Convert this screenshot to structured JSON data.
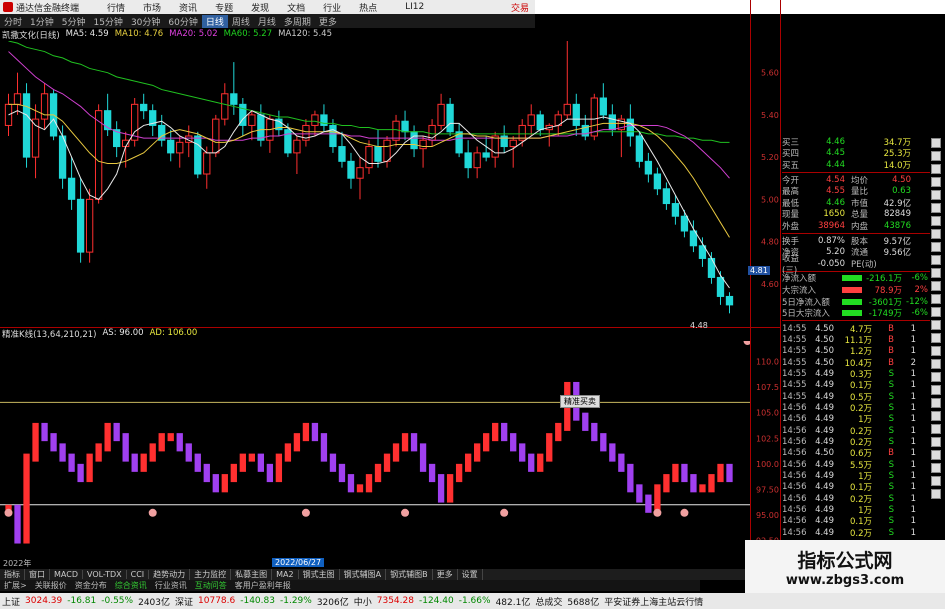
{
  "top_menu": {
    "app_title": "通达信金融终端",
    "items": [
      "行情",
      "市场",
      "资讯",
      "专题",
      "发现",
      "文档",
      "行业",
      "热点"
    ],
    "code": "LI12",
    "corner": "交易"
  },
  "period_bar": {
    "items": [
      "分时",
      "1分钟",
      "5分钟",
      "15分钟",
      "30分钟",
      "60分钟",
      "日线",
      "周线",
      "月线",
      "多周期",
      "更多"
    ],
    "active": "日线"
  },
  "ma_legend": {
    "name": "凯撒文化(日线)",
    "items": [
      {
        "label": "MA5: 4.59",
        "color": "#e8e8e8"
      },
      {
        "label": "MA10: 4.76",
        "color": "#e8d040"
      },
      {
        "label": "MA20: 5.02",
        "color": "#e040e0"
      },
      {
        "label": "MA60: 5.27",
        "color": "#20d020"
      },
      {
        "label": "MA120: 5.45",
        "color": "#cccccc"
      }
    ]
  },
  "indicator_legend": {
    "name": "精准K线(13,64,210,21)",
    "items": [
      "AS: 96.00",
      "AD: 106.00"
    ]
  },
  "price_axis": [
    "5.60",
    "5.40",
    "5.20",
    "5.00",
    "4.80",
    "4.60"
  ],
  "ind_axis": [
    "110.0",
    "107.5",
    "105.0",
    "102.5",
    "100.0",
    "97.50",
    "95.00",
    "92.50"
  ],
  "last_price_tag": "4.81",
  "low_label": "4.48",
  "floating_tip": "精准买卖",
  "date_start": "2022年",
  "date_label": "2022/06/27",
  "quote": {
    "bids": [
      {
        "label": "买三",
        "price": "4.46",
        "vol": "34.7万"
      },
      {
        "label": "买四",
        "price": "4.45",
        "vol": "25.3万"
      },
      {
        "label": "买五",
        "price": "4.44",
        "vol": "14.0万"
      }
    ],
    "stats": [
      {
        "l": "今开",
        "v": "4.54",
        "vc": "up",
        "l2": "均价",
        "v2": "4.50",
        "v2c": "up"
      },
      {
        "l": "最高",
        "v": "4.55",
        "vc": "up",
        "l2": "量比",
        "v2": "0.63",
        "v2c": "down"
      },
      {
        "l": "最低",
        "v": "4.46",
        "vc": "down",
        "l2": "市值",
        "v2": "42.9亿",
        "v2c": "neu"
      },
      {
        "l": "现量",
        "v": "1650",
        "vc": "yel",
        "l2": "总量",
        "v2": "82849",
        "v2c": "neu"
      },
      {
        "l": "外盘",
        "v": "38964",
        "vc": "up",
        "l2": "内盘",
        "v2": "43876",
        "v2c": "down"
      }
    ],
    "stats2": [
      {
        "l": "换手",
        "v": "0.87%",
        "vc": "neu",
        "l2": "股本",
        "v2": "9.57亿",
        "v2c": "neu"
      },
      {
        "l": "净资",
        "v": "5.20",
        "vc": "neu",
        "l2": "流通",
        "v2": "9.56亿",
        "v2c": "neu"
      },
      {
        "l": "收益(三)",
        "v": "-0.050",
        "vc": "neu",
        "l2": "PE(动)",
        "v2": "",
        "v2c": "neu"
      }
    ],
    "flows": [
      {
        "l": "净流入额",
        "v": "-216.1万",
        "pct": "-6%",
        "bar": "#22dd22"
      },
      {
        "l": "大宗流入",
        "v": "78.9万",
        "pct": "2%",
        "bar": "#ff4040"
      },
      {
        "l": "5日净流入额",
        "v": "-3601万",
        "pct": "-12%",
        "bar": "#22dd22"
      },
      {
        "l": "5日大宗流入",
        "v": "-1749万",
        "pct": "-6%",
        "bar": "#22dd22"
      }
    ],
    "ticks": [
      {
        "t": "14:55",
        "p": "4.50",
        "q": "4.7万",
        "bs": "B",
        "n": "1"
      },
      {
        "t": "14:55",
        "p": "4.50",
        "q": "11.1万",
        "bs": "B",
        "n": "1"
      },
      {
        "t": "14:55",
        "p": "4.50",
        "q": "1.2万",
        "bs": "B",
        "n": "1"
      },
      {
        "t": "14:55",
        "p": "4.50",
        "q": "10.4万",
        "bs": "B",
        "n": "2"
      },
      {
        "t": "14:55",
        "p": "4.49",
        "q": "0.3万",
        "bs": "S",
        "n": "1"
      },
      {
        "t": "14:55",
        "p": "4.49",
        "q": "0.1万",
        "bs": "S",
        "n": "1"
      },
      {
        "t": "14:55",
        "p": "4.49",
        "q": "0.5万",
        "bs": "S",
        "n": "1"
      },
      {
        "t": "14:56",
        "p": "4.49",
        "q": "0.2万",
        "bs": "S",
        "n": "1"
      },
      {
        "t": "14:56",
        "p": "4.49",
        "q": "1万",
        "bs": "S",
        "n": "1"
      },
      {
        "t": "14:56",
        "p": "4.49",
        "q": "0.2万",
        "bs": "S",
        "n": "1"
      },
      {
        "t": "14:56",
        "p": "4.49",
        "q": "0.2万",
        "bs": "S",
        "n": "1"
      },
      {
        "t": "14:56",
        "p": "4.50",
        "q": "0.6万",
        "bs": "B",
        "n": "1"
      },
      {
        "t": "14:56",
        "p": "4.49",
        "q": "5.5万",
        "bs": "S",
        "n": "1"
      },
      {
        "t": "14:56",
        "p": "4.49",
        "q": "1万",
        "bs": "S",
        "n": "1"
      },
      {
        "t": "14:56",
        "p": "4.49",
        "q": "0.1万",
        "bs": "S",
        "n": "1"
      },
      {
        "t": "14:56",
        "p": "4.49",
        "q": "0.2万",
        "bs": "S",
        "n": "1"
      },
      {
        "t": "14:56",
        "p": "4.49",
        "q": "1万",
        "bs": "S",
        "n": "1"
      },
      {
        "t": "14:56",
        "p": "4.49",
        "q": "0.1万",
        "bs": "S",
        "n": "1"
      },
      {
        "t": "14:56",
        "p": "4.49",
        "q": "0.2万",
        "bs": "S",
        "n": "1"
      }
    ]
  },
  "tabs_row1": [
    "指标",
    "窗口",
    "MACD",
    "VOL-TDX",
    "CCI",
    "趋势动力",
    "主力监控",
    "私募主图",
    "MA2",
    "钢式主图",
    "钢式辅图A",
    "钢式辅图B",
    "更多",
    "设置"
  ],
  "tabs_row2": [
    {
      "label": "扩展>",
      "green": false
    },
    {
      "label": "关联报价",
      "green": false
    },
    {
      "label": "资金分布",
      "green": false
    },
    {
      "label": "综合资讯",
      "green": true
    },
    {
      "label": "行业资讯",
      "green": false
    },
    {
      "label": "互动问答",
      "green": true
    },
    {
      "label": "客用户盈利年报",
      "green": false
    }
  ],
  "statusbar": {
    "items": [
      {
        "text": "上证",
        "c": ""
      },
      {
        "text": "3024.39",
        "c": "red"
      },
      {
        "text": "-16.81",
        "c": "grn"
      },
      {
        "text": "-0.55%",
        "c": "grn"
      },
      {
        "text": "2403亿",
        "c": ""
      },
      {
        "text": "深证",
        "c": ""
      },
      {
        "text": "10778.6",
        "c": "red"
      },
      {
        "text": "-140.83",
        "c": "grn"
      },
      {
        "text": "-1.29%",
        "c": "grn"
      },
      {
        "text": "3206亿",
        "c": ""
      },
      {
        "text": "中小",
        "c": ""
      },
      {
        "text": "7354.28",
        "c": "red"
      },
      {
        "text": "-124.40",
        "c": "grn"
      },
      {
        "text": "-1.66%",
        "c": "grn"
      },
      {
        "text": "482.1亿",
        "c": ""
      },
      {
        "text": "总成交",
        "c": ""
      },
      {
        "text": "5688亿",
        "c": ""
      },
      {
        "text": "平安证券上海主站云行情",
        "c": ""
      }
    ]
  },
  "watermark": {
    "main": "指标公式网",
    "sub": "www.zbgs3.com"
  },
  "chart_data": {
    "type": "candlestick",
    "title": "凯撒文化(日线)",
    "ylim": [
      4.4,
      5.75
    ],
    "candles": [
      [
        5.35,
        5.5,
        5.3,
        5.45
      ],
      [
        5.45,
        5.6,
        5.4,
        5.5
      ],
      [
        5.5,
        5.55,
        5.15,
        5.2
      ],
      [
        5.2,
        5.45,
        5.1,
        5.38
      ],
      [
        5.38,
        5.55,
        5.33,
        5.5
      ],
      [
        5.5,
        5.52,
        5.28,
        5.3
      ],
      [
        5.3,
        5.35,
        5.05,
        5.1
      ],
      [
        5.1,
        5.2,
        4.95,
        5.0
      ],
      [
        5.0,
        5.1,
        4.7,
        4.75
      ],
      [
        4.75,
        5.05,
        4.7,
        5.0
      ],
      [
        5.0,
        5.45,
        4.98,
        5.42
      ],
      [
        5.42,
        5.5,
        5.3,
        5.33
      ],
      [
        5.33,
        5.37,
        5.2,
        5.25
      ],
      [
        5.25,
        5.32,
        5.15,
        5.28
      ],
      [
        5.28,
        5.48,
        5.25,
        5.45
      ],
      [
        5.45,
        5.5,
        5.38,
        5.42
      ],
      [
        5.42,
        5.45,
        5.3,
        5.35
      ],
      [
        5.35,
        5.4,
        5.25,
        5.28
      ],
      [
        5.28,
        5.33,
        5.18,
        5.22
      ],
      [
        5.22,
        5.3,
        5.15,
        5.27
      ],
      [
        5.27,
        5.35,
        5.2,
        5.3
      ],
      [
        5.3,
        5.32,
        5.1,
        5.12
      ],
      [
        5.12,
        5.25,
        5.05,
        5.22
      ],
      [
        5.22,
        5.4,
        5.2,
        5.38
      ],
      [
        5.38,
        5.55,
        5.35,
        5.5
      ],
      [
        5.5,
        5.65,
        5.4,
        5.45
      ],
      [
        5.45,
        5.48,
        5.3,
        5.35
      ],
      [
        5.35,
        5.42,
        5.28,
        5.4
      ],
      [
        5.4,
        5.45,
        5.25,
        5.28
      ],
      [
        5.28,
        5.4,
        5.22,
        5.38
      ],
      [
        5.38,
        5.42,
        5.3,
        5.33
      ],
      [
        5.33,
        5.36,
        5.2,
        5.22
      ],
      [
        5.22,
        5.3,
        5.12,
        5.28
      ],
      [
        5.28,
        5.38,
        5.25,
        5.35
      ],
      [
        5.35,
        5.42,
        5.3,
        5.4
      ],
      [
        5.4,
        5.45,
        5.32,
        5.35
      ],
      [
        5.35,
        5.38,
        5.22,
        5.25
      ],
      [
        5.25,
        5.32,
        5.15,
        5.18
      ],
      [
        5.18,
        5.22,
        5.05,
        5.1
      ],
      [
        5.1,
        5.2,
        5.0,
        5.15
      ],
      [
        5.15,
        5.28,
        5.12,
        5.25
      ],
      [
        5.25,
        5.33,
        5.15,
        5.18
      ],
      [
        5.18,
        5.3,
        5.15,
        5.28
      ],
      [
        5.28,
        5.4,
        5.25,
        5.37
      ],
      [
        5.37,
        5.42,
        5.28,
        5.32
      ],
      [
        5.32,
        5.35,
        5.2,
        5.24
      ],
      [
        5.24,
        5.3,
        5.15,
        5.28
      ],
      [
        5.28,
        5.38,
        5.25,
        5.35
      ],
      [
        5.35,
        5.5,
        5.33,
        5.45
      ],
      [
        5.45,
        5.48,
        5.3,
        5.32
      ],
      [
        5.32,
        5.36,
        5.2,
        5.22
      ],
      [
        5.22,
        5.28,
        5.1,
        5.15
      ],
      [
        5.15,
        5.25,
        5.1,
        5.22
      ],
      [
        5.22,
        5.3,
        5.18,
        5.2
      ],
      [
        5.2,
        5.32,
        5.15,
        5.3
      ],
      [
        5.3,
        5.35,
        5.22,
        5.25
      ],
      [
        5.25,
        5.3,
        5.15,
        5.28
      ],
      [
        5.28,
        5.38,
        5.25,
        5.35
      ],
      [
        5.35,
        5.45,
        5.3,
        5.4
      ],
      [
        5.4,
        5.42,
        5.3,
        5.33
      ],
      [
        5.33,
        5.36,
        5.25,
        5.35
      ],
      [
        5.35,
        5.42,
        5.3,
        5.4
      ],
      [
        5.4,
        5.75,
        5.38,
        5.45
      ],
      [
        5.45,
        5.5,
        5.3,
        5.35
      ],
      [
        5.35,
        5.4,
        5.28,
        5.3
      ],
      [
        5.3,
        5.5,
        5.28,
        5.48
      ],
      [
        5.48,
        5.55,
        5.38,
        5.4
      ],
      [
        5.4,
        5.45,
        5.3,
        5.33
      ],
      [
        5.33,
        5.4,
        5.2,
        5.38
      ],
      [
        5.38,
        5.45,
        5.25,
        5.3
      ],
      [
        5.3,
        5.32,
        5.15,
        5.18
      ],
      [
        5.18,
        5.22,
        5.08,
        5.12
      ],
      [
        5.12,
        5.15,
        5.02,
        5.05
      ],
      [
        5.05,
        5.08,
        4.95,
        4.98
      ],
      [
        4.98,
        5.02,
        4.88,
        4.92
      ],
      [
        4.92,
        4.95,
        4.82,
        4.85
      ],
      [
        4.85,
        4.9,
        4.75,
        4.78
      ],
      [
        4.78,
        4.82,
        4.68,
        4.72
      ],
      [
        4.72,
        4.75,
        4.6,
        4.63
      ],
      [
        4.63,
        4.66,
        4.5,
        4.54
      ],
      [
        4.54,
        4.56,
        4.46,
        4.5
      ]
    ],
    "ma5": [
      5.4,
      5.42,
      5.4,
      5.35,
      5.33,
      5.38,
      5.3,
      5.2,
      5.1,
      5.02,
      5.0,
      5.05,
      5.12,
      5.25,
      5.32,
      5.35,
      5.36,
      5.37,
      5.34,
      5.3,
      5.28,
      5.26,
      5.22,
      5.22,
      5.25,
      5.32,
      5.38,
      5.42,
      5.4,
      5.38,
      5.37,
      5.34,
      5.3,
      5.29,
      5.3,
      5.32,
      5.33,
      5.31,
      5.26,
      5.2,
      5.17,
      5.17,
      5.18,
      5.22,
      5.27,
      5.3,
      5.3,
      5.29,
      5.32,
      5.36,
      5.36,
      5.32,
      5.28,
      5.25,
      5.22,
      5.22,
      5.24,
      5.27,
      5.3,
      5.33,
      5.34,
      5.35,
      5.38,
      5.38,
      5.38,
      5.38,
      5.39,
      5.38,
      5.37,
      5.36,
      5.32,
      5.25,
      5.18,
      5.1,
      5.02,
      4.94,
      4.86,
      4.79,
      4.72,
      4.64,
      4.58
    ],
    "ma10": [
      5.45,
      5.45,
      5.44,
      5.42,
      5.4,
      5.4,
      5.37,
      5.32,
      5.27,
      5.22,
      5.18,
      5.17,
      5.17,
      5.18,
      5.2,
      5.22,
      5.26,
      5.3,
      5.32,
      5.33,
      5.32,
      5.31,
      5.29,
      5.27,
      5.27,
      5.28,
      5.3,
      5.32,
      5.33,
      5.33,
      5.34,
      5.34,
      5.33,
      5.32,
      5.32,
      5.32,
      5.32,
      5.31,
      5.29,
      5.27,
      5.26,
      5.25,
      5.25,
      5.26,
      5.26,
      5.26,
      5.25,
      5.25,
      5.27,
      5.29,
      5.31,
      5.31,
      5.3,
      5.3,
      5.29,
      5.29,
      5.29,
      5.29,
      5.29,
      5.29,
      5.3,
      5.31,
      5.32,
      5.33,
      5.34,
      5.35,
      5.36,
      5.36,
      5.36,
      5.36,
      5.35,
      5.33,
      5.3,
      5.26,
      5.21,
      5.16,
      5.1,
      5.03,
      4.96,
      4.89,
      4.82
    ],
    "ma20": [
      5.7,
      5.66,
      5.62,
      5.58,
      5.55,
      5.52,
      5.5,
      5.47,
      5.44,
      5.4,
      5.37,
      5.34,
      5.32,
      5.31,
      5.3,
      5.29,
      5.29,
      5.29,
      5.29,
      5.29,
      5.29,
      5.29,
      5.29,
      5.28,
      5.28,
      5.28,
      5.28,
      5.29,
      5.29,
      5.3,
      5.3,
      5.31,
      5.31,
      5.31,
      5.31,
      5.31,
      5.31,
      5.31,
      5.3,
      5.3,
      5.29,
      5.29,
      5.29,
      5.29,
      5.29,
      5.29,
      5.29,
      5.28,
      5.28,
      5.28,
      5.29,
      5.29,
      5.29,
      5.29,
      5.29,
      5.29,
      5.29,
      5.29,
      5.29,
      5.29,
      5.3,
      5.3,
      5.3,
      5.31,
      5.31,
      5.32,
      5.33,
      5.33,
      5.34,
      5.35,
      5.35,
      5.35,
      5.35,
      5.34,
      5.32,
      5.3,
      5.27,
      5.23,
      5.19,
      5.15,
      5.1
    ],
    "ma60": [
      5.75,
      5.74,
      5.72,
      5.71,
      5.7,
      5.68,
      5.67,
      5.65,
      5.64,
      5.62,
      5.61,
      5.6,
      5.58,
      5.57,
      5.56,
      5.55,
      5.54,
      5.52,
      5.51,
      5.5,
      5.49,
      5.48,
      5.47,
      5.46,
      5.45,
      5.44,
      5.43,
      5.42,
      5.41,
      5.4,
      5.39,
      5.39,
      5.38,
      5.37,
      5.37,
      5.36,
      5.36,
      5.35,
      5.35,
      5.34,
      5.34,
      5.33,
      5.33,
      5.33,
      5.32,
      5.32,
      5.32,
      5.31,
      5.31,
      5.31,
      5.31,
      5.31,
      5.31,
      5.31,
      5.31,
      5.31,
      5.31,
      5.31,
      5.31,
      5.31,
      5.31,
      5.31,
      5.31,
      5.31,
      5.31,
      5.32,
      5.32,
      5.32,
      5.32,
      5.32,
      5.32,
      5.31,
      5.31,
      5.3,
      5.3,
      5.29,
      5.29,
      5.28,
      5.28,
      5.27,
      5.27
    ],
    "ind_levels": {
      "AS": 96.0,
      "AD": 106.0
    },
    "ind_ylim": [
      91.0,
      112.0
    ],
    "ind_bars": [
      96,
      93,
      101,
      104,
      103,
      102,
      101,
      100,
      99,
      101,
      102,
      104,
      103,
      101,
      100,
      101,
      102,
      103,
      103,
      102,
      101,
      100,
      99,
      98,
      99,
      100,
      101,
      101,
      100,
      99,
      101,
      102,
      103,
      104,
      103,
      101,
      100,
      99,
      98,
      98,
      99,
      100,
      101,
      102,
      103,
      102,
      100,
      99,
      97,
      99,
      100,
      101,
      102,
      103,
      104,
      103,
      102,
      101,
      100,
      101,
      103,
      104,
      108,
      105,
      104,
      103,
      102,
      101,
      100,
      98,
      97,
      96,
      98,
      99,
      100,
      99,
      98,
      98,
      99,
      100,
      99
    ],
    "ind_marks": [
      0,
      16,
      33,
      44,
      55,
      72,
      75,
      82
    ]
  }
}
